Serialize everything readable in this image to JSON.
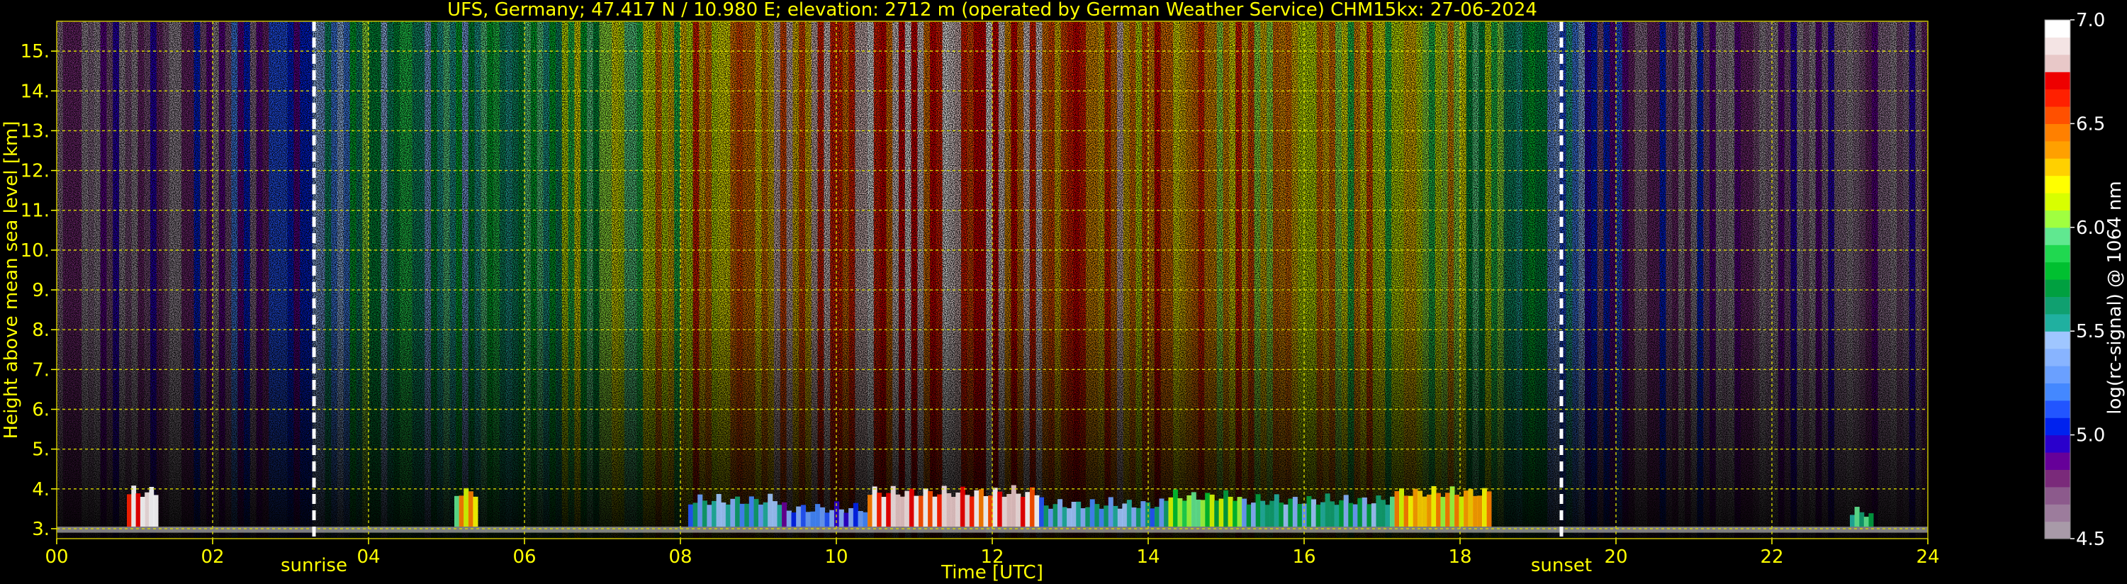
{
  "chart_data": {
    "type": "heatmap",
    "title": "UFS, Germany; 47.417 N / 10.980 E; elevation: 2712 m  (operated by German Weather Service)    CHM15kx: 27-06-2024",
    "xlabel": "Time [UTC]",
    "ylabel": "Height above mean sea level [km]",
    "xlim": [
      0,
      24
    ],
    "ylim": [
      2.75,
      15.75
    ],
    "x_ticks": [
      "00",
      "02",
      "04",
      "06",
      "08",
      "10",
      "12",
      "14",
      "16",
      "18",
      "20",
      "22",
      "24"
    ],
    "y_ticks": [
      "3.",
      "4.",
      "5.",
      "6.",
      "7.",
      "8.",
      "9.",
      "10.",
      "11.",
      "12.",
      "13.",
      "14.",
      "15."
    ],
    "grid": true,
    "annotations": [
      {
        "text": "sunrise",
        "x": 3.3
      },
      {
        "text": "sunset",
        "x": 19.3
      }
    ],
    "colorbar": {
      "label": "log(rc-signal) @ 1064 nm",
      "range": [
        4.5,
        7.0
      ],
      "ticks": [
        "4.5",
        "5.0",
        "5.5",
        "6.0",
        "6.5",
        "7.0"
      ],
      "colors": [
        "#a89aa8",
        "#9c7c9c",
        "#8c5a8c",
        "#7a2a7a",
        "#660099",
        "#2a00cc",
        "#0022ee",
        "#2255ff",
        "#4488ff",
        "#6aa0ff",
        "#88b4ff",
        "#9fc6ff",
        "#20b0a0",
        "#10a070",
        "#00a040",
        "#00c030",
        "#20d850",
        "#60e890",
        "#a0ff40",
        "#d8ff00",
        "#ffff00",
        "#ffd000",
        "#ffa000",
        "#ff8000",
        "#ff5000",
        "#ff2000",
        "#ee0000",
        "#e8c8c8",
        "#f4e4e4",
        "#ffffff"
      ]
    },
    "series": [
      {
        "values": [
          [
            0.0,
            0.05
          ],
          [
            1.0,
            0.06
          ],
          [
            2.0,
            0.1
          ],
          [
            3.0,
            0.2
          ],
          [
            4.0,
            0.5
          ],
          [
            5.0,
            0.45
          ],
          [
            6.0,
            0.5
          ],
          [
            7.0,
            0.6
          ],
          [
            8.0,
            0.7
          ],
          [
            9.0,
            0.78
          ],
          [
            10.0,
            0.88
          ],
          [
            11.0,
            0.92
          ],
          [
            12.0,
            0.9
          ],
          [
            13.0,
            0.82
          ],
          [
            14.0,
            0.78
          ],
          [
            15.0,
            0.74
          ],
          [
            16.0,
            0.72
          ],
          [
            17.0,
            0.68
          ],
          [
            18.0,
            0.62
          ],
          [
            19.0,
            0.45
          ],
          [
            20.0,
            0.12
          ],
          [
            21.0,
            0.07
          ],
          [
            22.0,
            0.06
          ],
          [
            23.0,
            0.05
          ],
          [
            24.0,
            0.05
          ]
        ]
      }
    ],
    "boundary_layer_events": [
      {
        "x0": 0.9,
        "x1": 1.3,
        "top": 4.1,
        "level": 0.95
      },
      {
        "x0": 5.1,
        "x1": 5.4,
        "top": 4.1,
        "level": 0.7
      },
      {
        "x0": 8.1,
        "x1": 9.3,
        "top": 3.9,
        "level": 0.35
      },
      {
        "x0": 9.3,
        "x1": 10.4,
        "top": 3.7,
        "level": 0.25
      },
      {
        "x0": 10.4,
        "x1": 12.6,
        "top": 4.1,
        "level": 0.9
      },
      {
        "x0": 12.6,
        "x1": 14.2,
        "top": 3.8,
        "level": 0.35
      },
      {
        "x0": 14.2,
        "x1": 15.2,
        "top": 4.0,
        "level": 0.55
      },
      {
        "x0": 15.2,
        "x1": 17.1,
        "top": 3.9,
        "level": 0.4
      },
      {
        "x0": 17.1,
        "x1": 18.4,
        "top": 4.1,
        "level": 0.7
      },
      {
        "x0": 23.0,
        "x1": 23.3,
        "top": 3.6,
        "level": 0.5
      }
    ]
  }
}
